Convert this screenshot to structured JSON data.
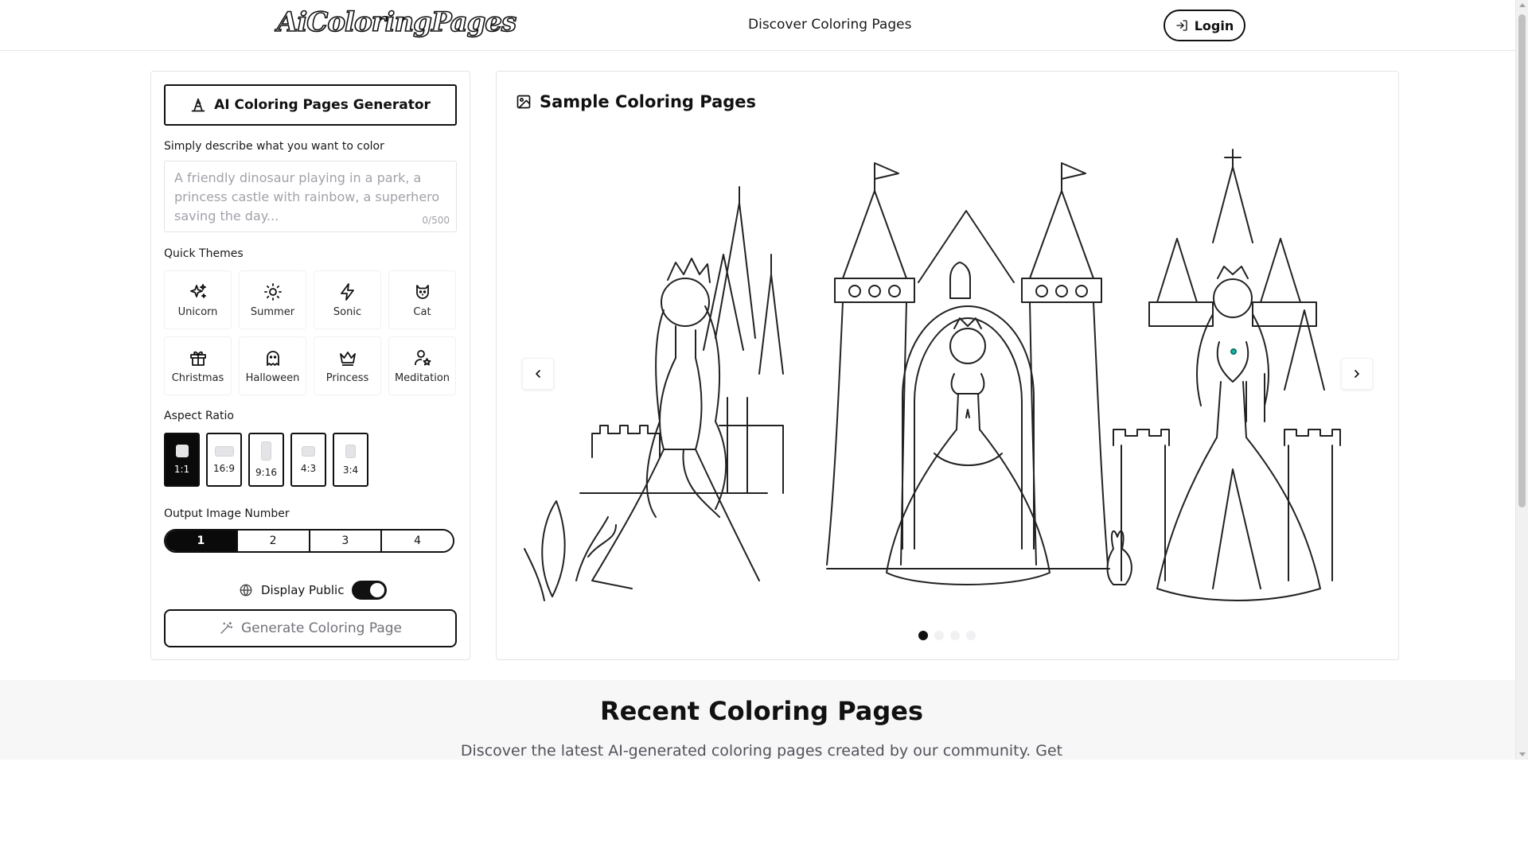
{
  "header": {
    "logo_text": "AiColoringPages",
    "nav_link": "Discover Coloring Pages",
    "login_label": "Login"
  },
  "generator": {
    "title": "AI Coloring Pages Generator",
    "describe_label": "Simply describe what you want to color",
    "prompt_placeholder": "A friendly dinosaur playing in a park, a princess castle with rainbow, a superhero saving the day...",
    "prompt_value": "",
    "char_counter": "0/500",
    "quick_themes_label": "Quick Themes",
    "themes": [
      {
        "label": "Unicorn",
        "icon": "sparkles-icon"
      },
      {
        "label": "Summer",
        "icon": "sun-icon"
      },
      {
        "label": "Sonic",
        "icon": "lightning-icon"
      },
      {
        "label": "Cat",
        "icon": "cat-icon"
      },
      {
        "label": "Christmas",
        "icon": "gift-icon"
      },
      {
        "label": "Halloween",
        "icon": "ghost-icon"
      },
      {
        "label": "Princess",
        "icon": "crown-icon"
      },
      {
        "label": "Meditation",
        "icon": "person-star-icon"
      }
    ],
    "aspect_ratio_label": "Aspect Ratio",
    "aspect_ratios": [
      "1:1",
      "16:9",
      "9:16",
      "4:3",
      "3:4"
    ],
    "aspect_ratio_selected": "1:1",
    "output_number_label": "Output Image Number",
    "output_numbers": [
      "1",
      "2",
      "3",
      "4"
    ],
    "output_number_selected": "1",
    "display_public_label": "Display Public",
    "display_public_on": true,
    "generate_label": "Generate Coloring Page"
  },
  "samples": {
    "title": "Sample Coloring Pages",
    "slide_count": 4,
    "active_slide": 1,
    "image_subject": "princess castle coloring page"
  },
  "recent": {
    "title": "Recent Coloring Pages",
    "subtitle": "Discover the latest AI-generated coloring pages created by our community. Get"
  },
  "colors": {
    "primary": "#111111",
    "border": "#e4e4e7",
    "muted_text": "#a1a1aa",
    "section_bg": "#f7f7f7"
  }
}
